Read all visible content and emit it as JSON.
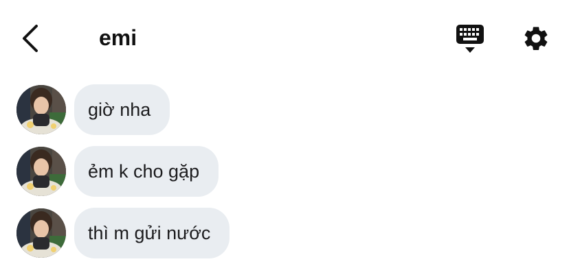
{
  "header": {
    "title": "emi",
    "back_icon": "chevron-left-icon",
    "keyboard_icon": "keyboard-icon",
    "settings_icon": "gear-icon"
  },
  "messages": [
    {
      "text": "giờ nha"
    },
    {
      "text": "ẻm k cho gặp"
    },
    {
      "text": "thì m gửi nước"
    }
  ],
  "colors": {
    "bubble": "#e9edf1",
    "text": "#1c1c1e",
    "icon": "#111111"
  }
}
